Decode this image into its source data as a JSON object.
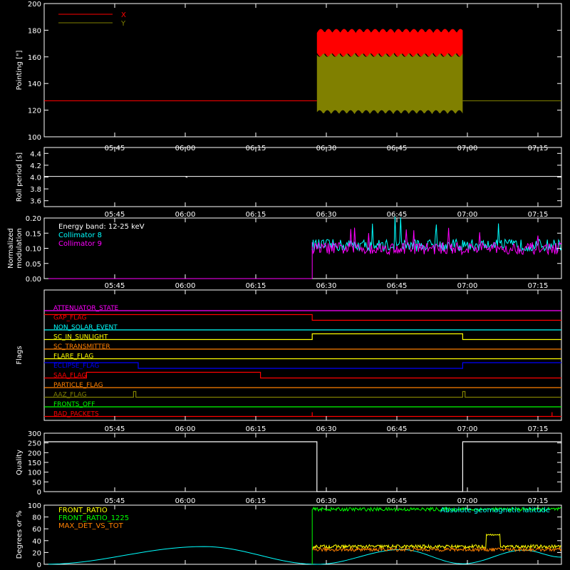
{
  "chart_data": [
    {
      "type": "line",
      "ylabel": "Pointing [\"]",
      "ylim": [
        100,
        200
      ],
      "yticks": [
        "100",
        "120",
        "140",
        "160",
        "180",
        "200"
      ],
      "xticks": [
        "05:45",
        "06:00",
        "06:15",
        "06:30",
        "06:45",
        "07:00",
        "07:15"
      ],
      "legend": [
        {
          "name": "X",
          "color": "#ff0000"
        },
        {
          "name": "Y",
          "color": "#808000"
        }
      ],
      "series": [
        {
          "name": "X",
          "color": "#ff0000",
          "baseline": 127,
          "active_start": "06:28",
          "active_end": "06:59",
          "band_low": 118,
          "band_high": 175
        },
        {
          "name": "Y",
          "color": "#808000",
          "baseline": 127,
          "active_start": "06:28",
          "active_end": "06:59",
          "band_low": 118,
          "band_high": 165
        }
      ]
    },
    {
      "type": "line",
      "ylabel": "Roll period [s]",
      "ylim": [
        3.5,
        4.5
      ],
      "yticks": [
        "3.6",
        "3.8",
        "4.0",
        "4.2",
        "4.4"
      ],
      "xticks": [
        "05:45",
        "06:00",
        "06:15",
        "06:30",
        "06:45",
        "07:00",
        "07:15"
      ],
      "series": [
        {
          "name": "",
          "color": "#ffffff",
          "value": 4.01
        }
      ]
    },
    {
      "type": "line",
      "ylabel": "Normalized modulation",
      "ylabel_lines": [
        "Normalized",
        "modulation"
      ],
      "ylim": [
        0,
        0.2
      ],
      "yticks": [
        "0.00",
        "0.05",
        "0.10",
        "0.15",
        "0.20"
      ],
      "xticks": [
        "05:45",
        "06:00",
        "06:15",
        "06:30",
        "06:45",
        "07:00",
        "07:15"
      ],
      "annotation": "Energy band: 12-25 keV",
      "legend": [
        {
          "name": "Collimator 8",
          "color": "#00ffff"
        },
        {
          "name": "Collimator 9",
          "color": "#ff00ff"
        }
      ],
      "series": [
        {
          "name": "Collimator 8",
          "color": "#00ffff",
          "start": "06:27",
          "typical_low": 0.09,
          "typical_high": 0.13
        },
        {
          "name": "Collimator 9",
          "color": "#ff00ff",
          "start": "06:27",
          "typical_low": 0.08,
          "typical_high": 0.12
        }
      ]
    },
    {
      "type": "line",
      "ylabel": "Flags",
      "xticks": [
        "05:45",
        "06:00",
        "06:15",
        "06:30",
        "06:45",
        "07:00",
        "07:15"
      ],
      "flags": [
        {
          "name": "ATTENUATOR_STATE",
          "color": "#ff00ff",
          "segments": [
            [
              "05:30",
              "07:20",
              0
            ]
          ]
        },
        {
          "name": "GAP_FLAG",
          "color": "#ff0000",
          "segments": [
            [
              "05:30",
              "06:27",
              1
            ],
            [
              "06:27",
              "07:20",
              0
            ]
          ]
        },
        {
          "name": "NON_SOLAR_EVENT",
          "color": "#00ffff",
          "segments": [
            [
              "05:30",
              "07:20",
              0
            ]
          ]
        },
        {
          "name": "SC_IN_SUNLIGHT",
          "color": "#ffff00",
          "segments": [
            [
              "05:30",
              "06:27",
              0
            ],
            [
              "06:27",
              "06:59",
              1
            ],
            [
              "06:59",
              "07:20",
              0
            ]
          ]
        },
        {
          "name": "SC_TRANSMITTER",
          "color": "#ff8000",
          "segments": [
            [
              "05:30",
              "07:20",
              0
            ]
          ]
        },
        {
          "name": "FLARE_FLAG",
          "color": "#ffff00",
          "segments": [
            [
              "05:30",
              "07:20",
              0
            ]
          ]
        },
        {
          "name": "ECLIPSE_FLAG",
          "color": "#0000ff",
          "segments": [
            [
              "05:30",
              "05:50",
              1
            ],
            [
              "05:50",
              "06:59",
              0
            ],
            [
              "06:59",
              "07:20",
              1
            ]
          ]
        },
        {
          "name": "SAA_FLAG",
          "color": "#ff0000",
          "segments": [
            [
              "05:30",
              "05:39",
              0
            ],
            [
              "05:39",
              "06:16",
              1
            ],
            [
              "06:16",
              "07:20",
              0
            ]
          ]
        },
        {
          "name": "PARTICLE_FLAG",
          "color": "#ff8000",
          "segments": [
            [
              "05:30",
              "07:20",
              0
            ]
          ]
        },
        {
          "name": "AAZ_FLAG",
          "color": "#808000",
          "segments": [
            [
              "05:30",
              "05:49",
              0
            ],
            [
              "05:49",
              "05:49.5",
              1
            ],
            [
              "05:49.5",
              "06:59",
              0
            ],
            [
              "06:59",
              "06:59.5",
              1
            ],
            [
              "06:59.5",
              "07:20",
              0
            ]
          ]
        },
        {
          "name": "FRONTS_OFF",
          "color": "#00ff00",
          "segments": [
            [
              "05:30",
              "07:20",
              0
            ]
          ]
        },
        {
          "name": "BAD_PACKETS",
          "color": "#ff0000",
          "segments": [
            [
              "05:30",
              "07:20",
              0
            ]
          ],
          "spikes": [
            "06:27",
            "07:18"
          ]
        }
      ]
    },
    {
      "type": "line",
      "ylabel": "Quality",
      "ylim": [
        0,
        300
      ],
      "yticks": [
        "0",
        "50",
        "100",
        "150",
        "200",
        "250",
        "300"
      ],
      "xticks": [
        "05:45",
        "06:00",
        "06:15",
        "06:30",
        "06:45",
        "07:00",
        "07:15"
      ],
      "series": [
        {
          "name": "",
          "color": "#ffffff",
          "segments": [
            [
              "05:30",
              "06:28",
              256
            ],
            [
              "06:28",
              "06:59",
              0
            ],
            [
              "06:59",
              "07:20",
              256
            ]
          ]
        }
      ]
    },
    {
      "type": "line",
      "ylabel": "Degrees or %",
      "ylim": [
        0,
        100
      ],
      "yticks": [
        "0",
        "20",
        "40",
        "60",
        "80",
        "100"
      ],
      "xticks": [
        "05:45",
        "06:00",
        "06:15",
        "06:30",
        "06:45",
        "07:00",
        "07:15"
      ],
      "legend": [
        {
          "name": "FRONT_RATIO",
          "color": "#ffff00"
        },
        {
          "name": "FRONT_RATIO_1225",
          "color": "#00ff00"
        },
        {
          "name": "MAX_DET_VS_TOT",
          "color": "#ff8000"
        }
      ],
      "annotation": "Absolute geomagnetic latitude",
      "annotation_color": "#00ffff",
      "series": [
        {
          "name": "Absolute geomagnetic latitude",
          "color": "#00ffff",
          "peaks": [
            [
              "06:04",
              30
            ],
            [
              "06:46",
              25
            ],
            [
              "07:12",
              24
            ]
          ],
          "troughs": [
            [
              "05:30",
              0
            ],
            [
              "06:28",
              0
            ],
            [
              "06:59",
              1
            ]
          ]
        },
        {
          "name": "FRONT_RATIO",
          "color": "#ffff00",
          "start": "06:27",
          "typical": 30,
          "bump": [
            "07:04",
            "07:07",
            50
          ]
        },
        {
          "name": "FRONT_RATIO_1225",
          "color": "#00ff00",
          "start": "06:27",
          "typical": 93
        },
        {
          "name": "MAX_DET_VS_TOT",
          "color": "#ff8000",
          "start": "06:27",
          "typical": 25
        }
      ]
    }
  ]
}
